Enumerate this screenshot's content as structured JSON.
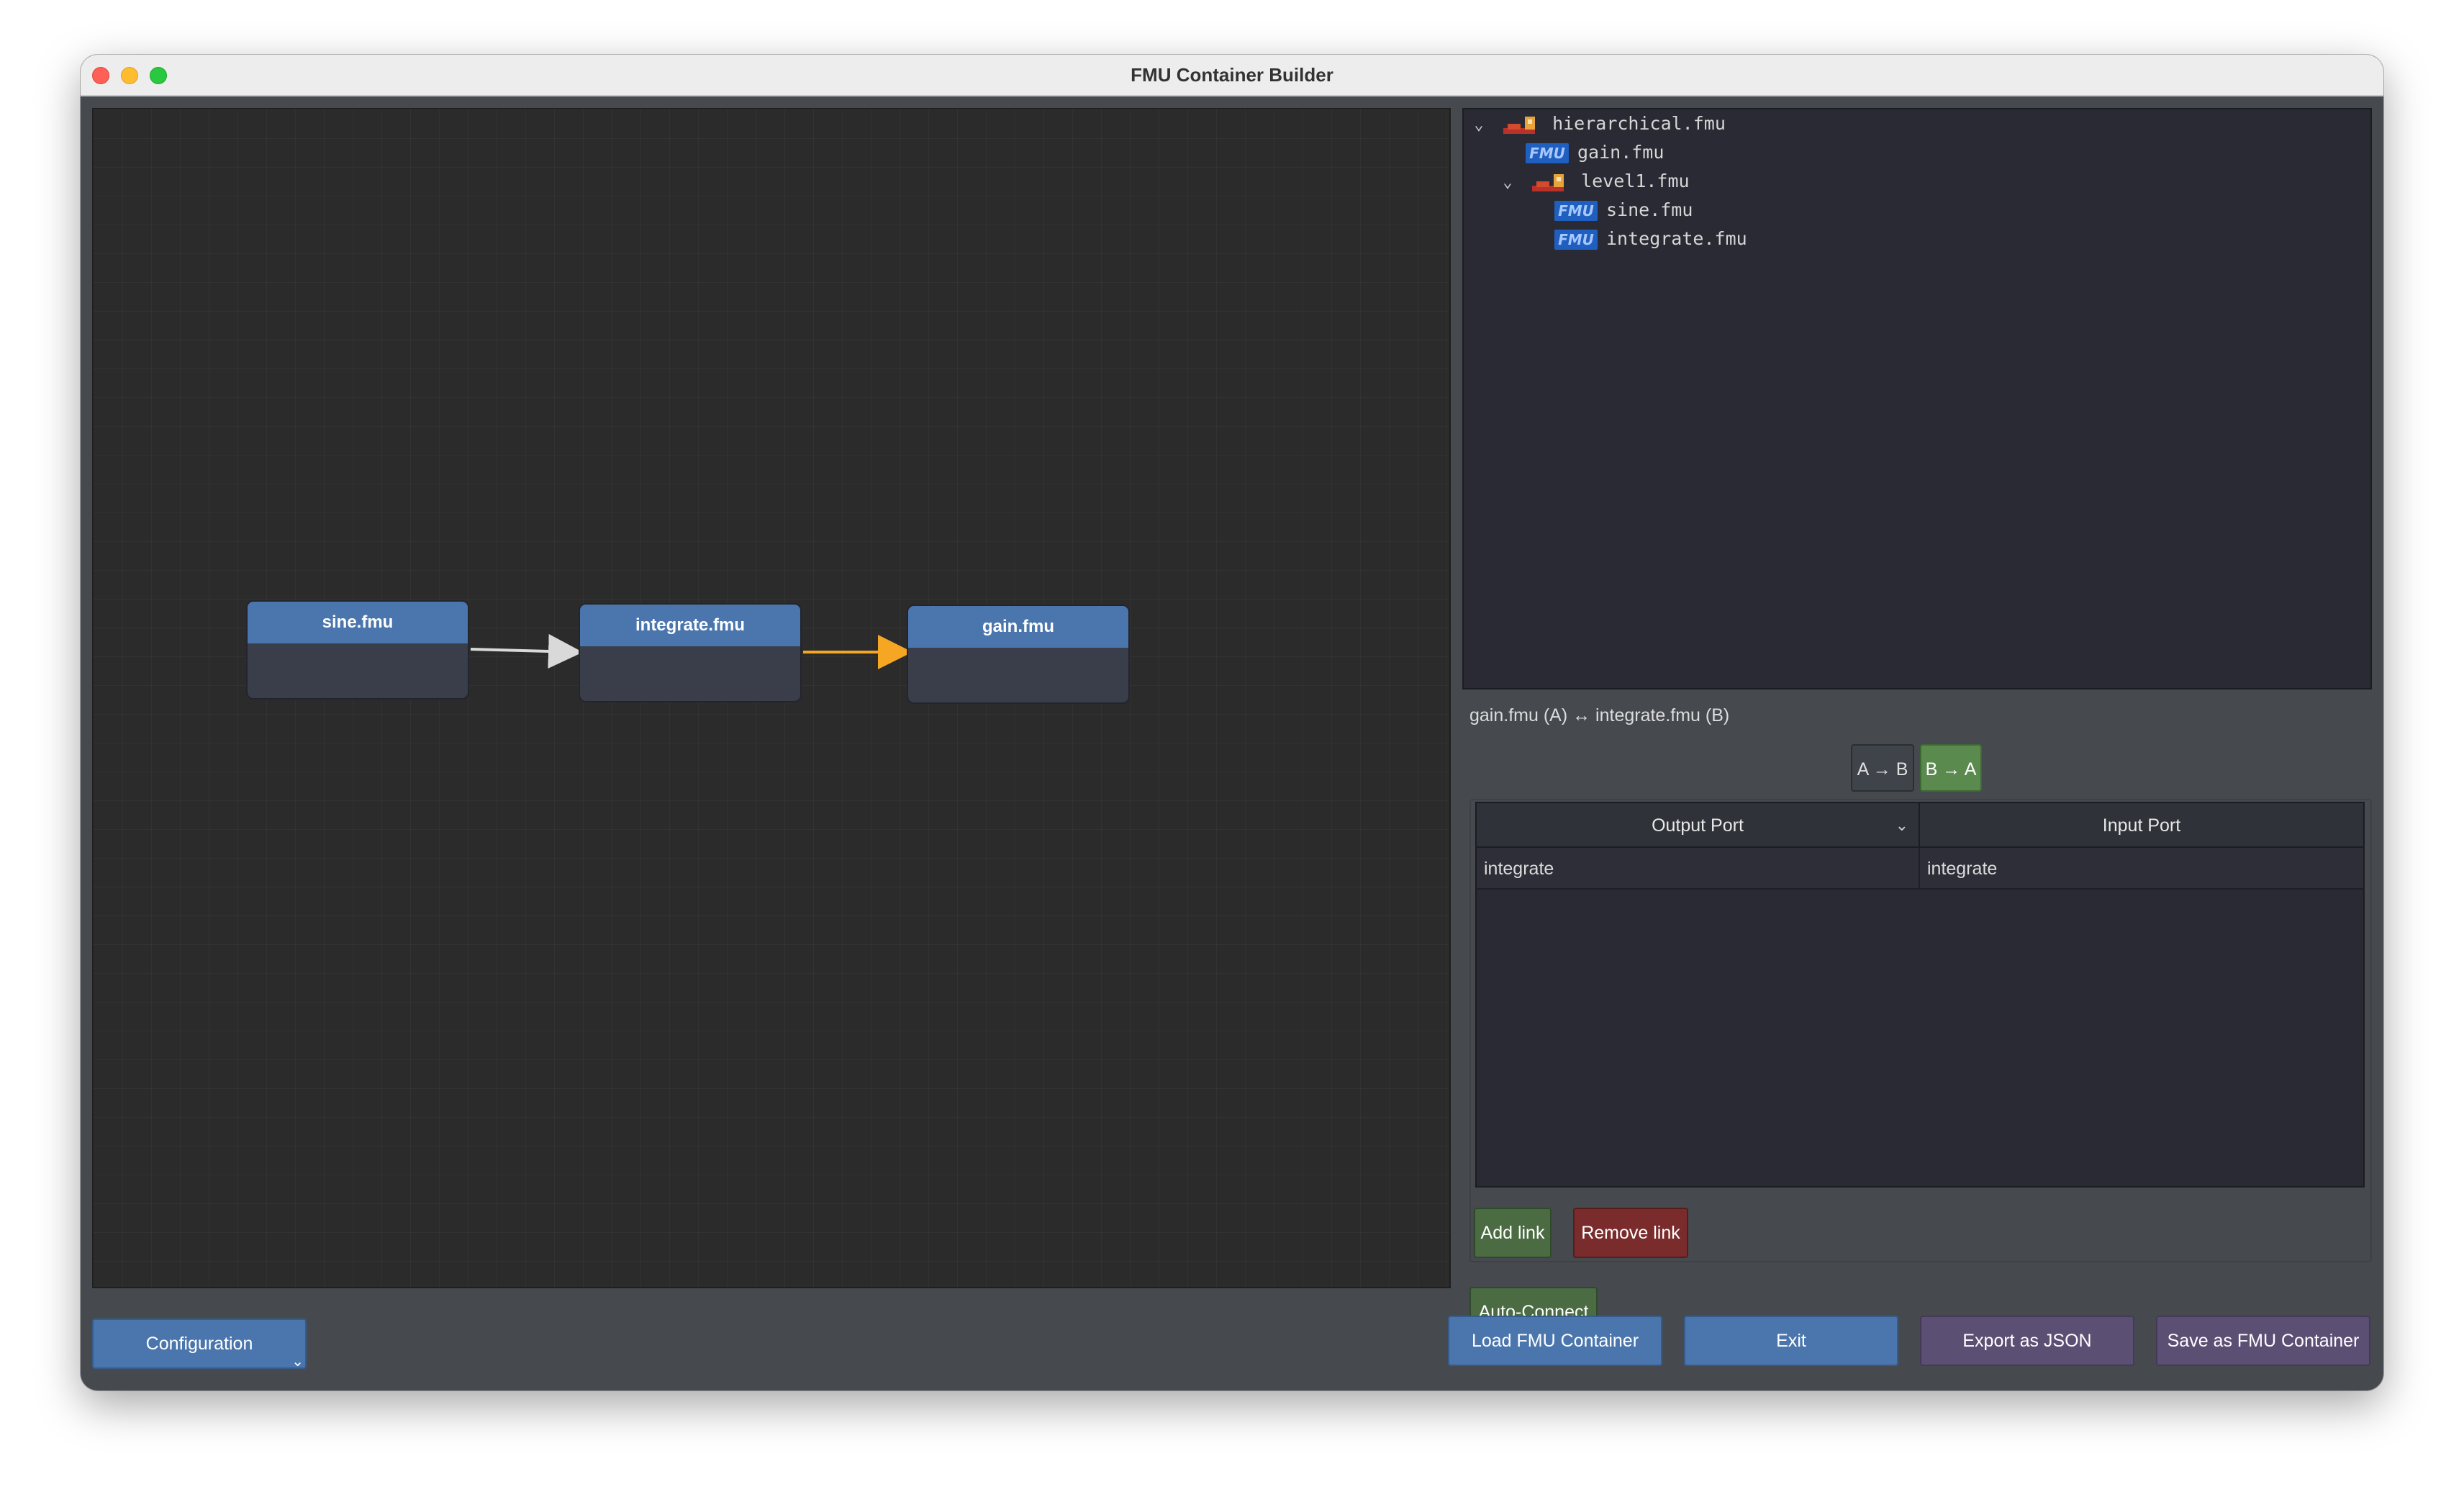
{
  "window": {
    "title": "FMU Container Builder"
  },
  "canvas": {
    "nodes": [
      {
        "label": "sine.fmu"
      },
      {
        "label": "integrate.fmu"
      },
      {
        "label": "gain.fmu"
      }
    ],
    "link_colors": {
      "default": "#d9d9d9",
      "selected": "#f5a623"
    }
  },
  "tree": {
    "items": [
      {
        "label": "hierarchical.fmu",
        "icon": "container-icon",
        "expanded": true
      },
      {
        "label": "gain.fmu",
        "icon": "fmu-icon"
      },
      {
        "label": "level1.fmu",
        "icon": "container-icon",
        "expanded": true
      },
      {
        "label": "sine.fmu",
        "icon": "fmu-icon"
      },
      {
        "label": "integrate.fmu",
        "icon": "fmu-icon"
      }
    ],
    "fmu_icon_text": "FMU"
  },
  "links_panel": {
    "pair_label": "gain.fmu (A) ↔ integrate.fmu (B)",
    "direction_ab": "A → B",
    "direction_ba": "B → A",
    "columns": {
      "output": "Output Port",
      "input": "Input Port"
    },
    "rows": [
      {
        "output": "integrate",
        "input": "integrate"
      }
    ],
    "add_label": "Add link",
    "remove_label": "Remove link"
  },
  "buttons": {
    "auto_connect": "Auto-Connect",
    "configuration": "Configuration",
    "load": "Load FMU Container",
    "exit": "Exit",
    "export_json": "Export as JSON",
    "save_fmu": "Save as FMU Container"
  },
  "colors": {
    "node_header": "#4a76ad",
    "green_button": "#4b6b43",
    "red_button": "#7a2c2c",
    "purple_button": "#5c4f74"
  }
}
